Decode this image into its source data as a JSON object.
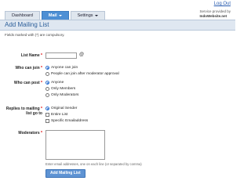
{
  "header": {
    "logout": "Log Out",
    "service_prefix": "Service provided by",
    "service_brand": "IndoWebsite.net"
  },
  "nav": {
    "dashboard": "Dashboard",
    "mail": "Mail",
    "settings": "Settings"
  },
  "page": {
    "title": "Add Mailing List",
    "note": "Fields marked with (*) are compulsory."
  },
  "form": {
    "list_name": {
      "label": "List Name",
      "value": ""
    },
    "join": {
      "label": "Who can join",
      "options": [
        "Anyone can join",
        "People can join after moderator approval"
      ],
      "selected": "Anyone can join"
    },
    "post": {
      "label": "Who can post",
      "options": [
        "Anyone",
        "Only Members",
        "Only Moderators"
      ],
      "selected": "Anyone"
    },
    "replies": {
      "label_line1": "Replies to mailing",
      "label_line2": "list go to",
      "options": [
        "Original Sender",
        "Entire List",
        "Specific Emailaddress"
      ],
      "selected": "Original Sender"
    },
    "moderators": {
      "label": "Moderators",
      "value": "",
      "helper": "Enter email addresses, one on each line (or separated by comma)"
    },
    "submit_label": "Add Mailing List"
  }
}
